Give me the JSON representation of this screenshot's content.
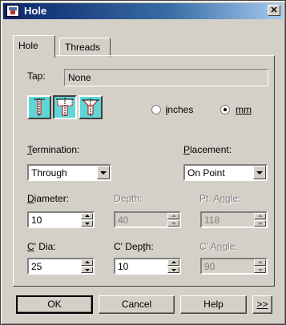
{
  "window": {
    "title": "Hole",
    "close_glyph": "✕"
  },
  "tabs": [
    {
      "label": "Hole",
      "active": true
    },
    {
      "label": "Threads",
      "active": false
    }
  ],
  "tap": {
    "label": "Tap:",
    "value": "None"
  },
  "hole_types": [
    {
      "icon": "simple-hole-icon",
      "pressed": false
    },
    {
      "icon": "counterbore-hole-icon",
      "pressed": true
    },
    {
      "icon": "countersink-hole-icon",
      "pressed": false
    }
  ],
  "units": {
    "inches_label": "inches",
    "mm_label": "mm",
    "selected": "mm"
  },
  "termination": {
    "label_first": "T",
    "label_rest": "ermination:",
    "value": "Through"
  },
  "placement": {
    "label_first": "P",
    "label_rest": "lacement:",
    "value": "On Point"
  },
  "diameter": {
    "label_first": "D",
    "label_rest": "iameter:",
    "value": "10"
  },
  "depth": {
    "label": "Depth:",
    "value": "40"
  },
  "pt_angle": {
    "label_pre": "Pt. A",
    "label_u": "n",
    "label_post": "gle:",
    "value": "118"
  },
  "c_dia": {
    "label_first": "C",
    "label_rest": "' Dia:",
    "value": "25"
  },
  "c_depth": {
    "label_pre": "C' Dep",
    "label_u": "t",
    "label_post": "h:",
    "value": "10"
  },
  "c_angle": {
    "label_pre": "C' A",
    "label_u": "n",
    "label_post": "gle:",
    "value": "90"
  },
  "buttons": {
    "ok": "OK",
    "cancel": "Cancel",
    "help": "Help",
    "more": ">>"
  },
  "colors": {
    "icon_cyan": "#5fd6d6",
    "titlebar_start": "#0a246a"
  }
}
